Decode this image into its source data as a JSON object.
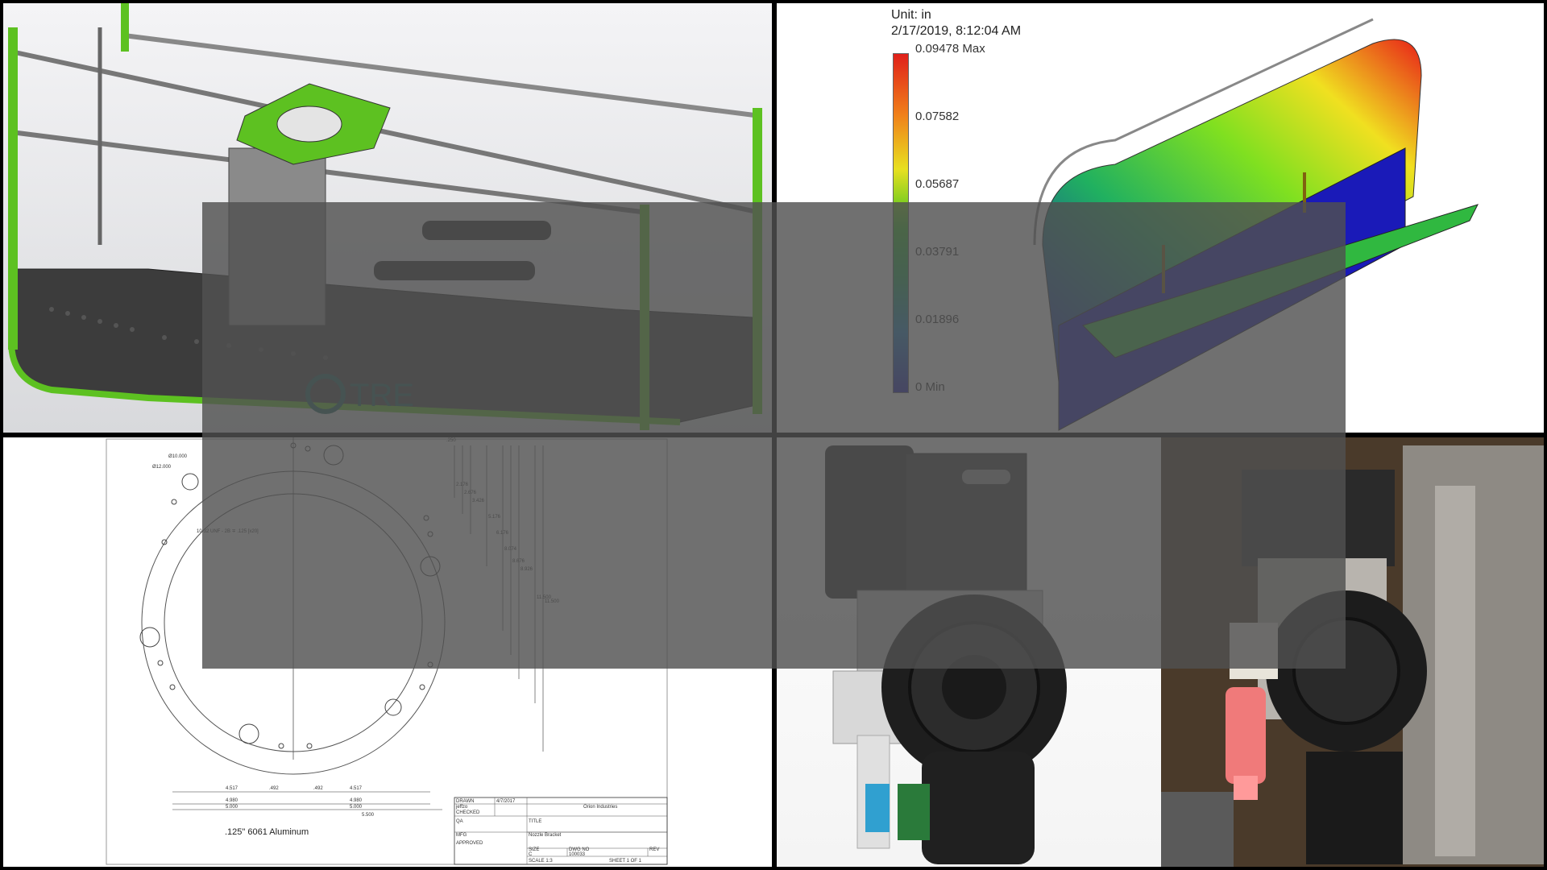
{
  "fea": {
    "unit": "Unit: in",
    "timestamp": "2/17/2019, 8:12:04 AM",
    "legend": [
      "0.09478 Max",
      "0.07582",
      "0.05687",
      "0.03791",
      "0.01896",
      "0 Min"
    ]
  },
  "drawing": {
    "material": ".125\" 6061 Aluminum",
    "company": "Orion Industries",
    "title": "Nozzle Bracket",
    "dwg_no": "100033",
    "size": "C",
    "rev": "REV",
    "scale": "SCALE 1:3",
    "sheet": "SHEET 1 OF 1",
    "date": "4/7/2017",
    "drawn": "DRAWN",
    "drawn_by": "jeffzo",
    "checked": "CHECKED",
    "qa": "QA",
    "mfg": "MFG",
    "approved": "APPROVED",
    "title_label": "TITLE",
    "size_label": "SIZE",
    "dwgno_label": "DWG NO",
    "hole_note": "10-32 UNF - 2B ∓ .125 [x20]",
    "dia1": "Ø10.000",
    "dia2": "Ø12.000",
    "dims_bottom": [
      "4.517",
      ".492",
      ".492",
      "4.517",
      "4.980",
      "4.980",
      "5.000",
      "5.000",
      "5.500"
    ],
    "dims_right": [
      "2.176",
      "2.676",
      "3.426",
      "5.176",
      "6.176",
      "8.074",
      "8.676",
      "8.926",
      "11.500",
      "11.500"
    ],
    "top_dim": ".250"
  },
  "cad": {
    "brand_text": "TRE"
  },
  "colors": {
    "frame_green": "#5dc121",
    "overlay": "#505050"
  }
}
